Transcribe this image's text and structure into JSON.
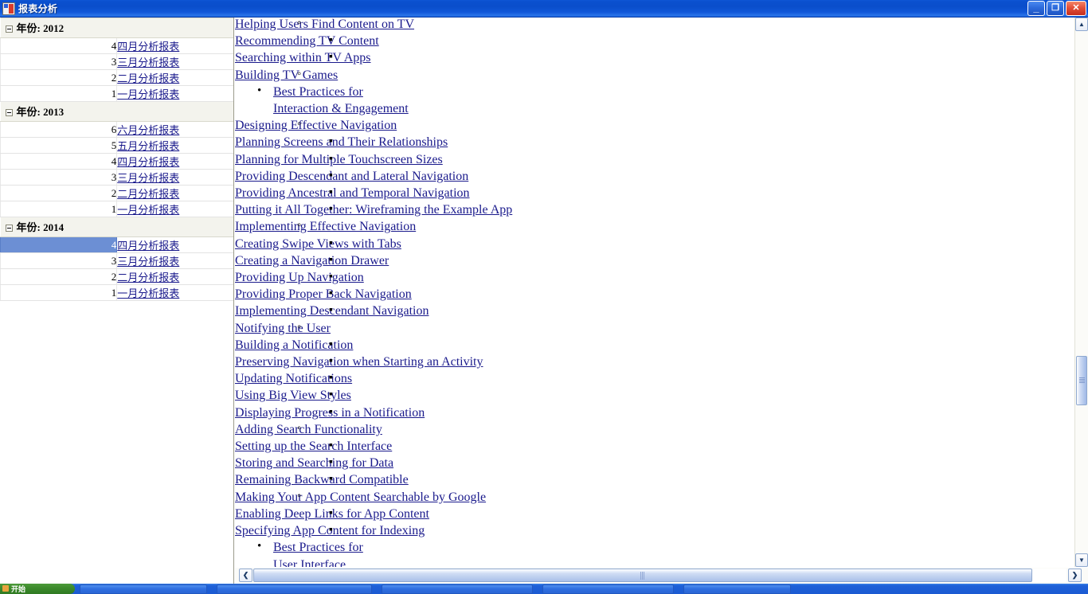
{
  "window": {
    "title": "报表分析",
    "icon": "report-window-icon",
    "buttons": {
      "minimize": "_",
      "restore": "❐",
      "close": "✕"
    }
  },
  "sidebar": {
    "groups": [
      {
        "label": "年份: 2012",
        "expander": "collapse-box",
        "rows": [
          {
            "num": "4",
            "link": "四月分析报表",
            "selected": false
          },
          {
            "num": "3",
            "link": "三月分析报表",
            "selected": false
          },
          {
            "num": "2",
            "link": "二月分析报表",
            "selected": false
          },
          {
            "num": "1",
            "link": "一月分析报表",
            "selected": false
          }
        ]
      },
      {
        "label": "年份: 2013",
        "expander": "collapse-box",
        "rows": [
          {
            "num": "6",
            "link": "六月分析报表",
            "selected": false
          },
          {
            "num": "5",
            "link": "五月分析报表",
            "selected": false
          },
          {
            "num": "4",
            "link": "四月分析报表",
            "selected": false
          },
          {
            "num": "3",
            "link": "三月分析报表",
            "selected": false
          },
          {
            "num": "2",
            "link": "二月分析报表",
            "selected": false
          },
          {
            "num": "1",
            "link": "一月分析报表",
            "selected": false
          }
        ]
      },
      {
        "label": "年份: 2014",
        "expander": "collapse-box",
        "rows": [
          {
            "num": "4",
            "link": "四月分析报表",
            "selected": true
          },
          {
            "num": "3",
            "link": "三月分析报表",
            "selected": false
          },
          {
            "num": "2",
            "link": "二月分析报表",
            "selected": false
          },
          {
            "num": "1",
            "link": "一月分析报表",
            "selected": false
          }
        ]
      }
    ]
  },
  "content": {
    "items": [
      {
        "level": 2,
        "text": "Helping Users Find Content on TV"
      },
      {
        "level": 3,
        "text": "Recommending TV Content"
      },
      {
        "level": 3,
        "text": "Searching within TV Apps"
      },
      {
        "level": 2,
        "text": "Building TV Games"
      },
      {
        "level": 1,
        "text": "Best Practices for Interaction & Engagement",
        "wrap": true
      },
      {
        "level": 2,
        "text": "Designing Effective Navigation"
      },
      {
        "level": 3,
        "text": "Planning Screens and Their Relationships"
      },
      {
        "level": 3,
        "text": "Planning for Multiple Touchscreen Sizes"
      },
      {
        "level": 3,
        "text": "Providing Descendant and Lateral Navigation"
      },
      {
        "level": 3,
        "text": "Providing Ancestral and Temporal Navigation"
      },
      {
        "level": 3,
        "text": "Putting it All Together: Wireframing the Example App"
      },
      {
        "level": 2,
        "text": "Implementing Effective Navigation"
      },
      {
        "level": 3,
        "text": "Creating Swipe Views with Tabs"
      },
      {
        "level": 3,
        "text": "Creating a Navigation Drawer"
      },
      {
        "level": 3,
        "text": "Providing Up Navigation"
      },
      {
        "level": 3,
        "text": "Providing Proper Back Navigation"
      },
      {
        "level": 3,
        "text": "Implementing Descendant Navigation"
      },
      {
        "level": 2,
        "text": "Notifying the User"
      },
      {
        "level": 3,
        "text": "Building a Notification"
      },
      {
        "level": 3,
        "text": "Preserving Navigation when Starting an Activity"
      },
      {
        "level": 3,
        "text": "Updating Notifications"
      },
      {
        "level": 3,
        "text": "Using Big View Styles"
      },
      {
        "level": 3,
        "text": "Displaying Progress in a Notification"
      },
      {
        "level": 2,
        "text": "Adding Search Functionality"
      },
      {
        "level": 3,
        "text": "Setting up the Search Interface"
      },
      {
        "level": 3,
        "text": "Storing and Searching for Data"
      },
      {
        "level": 3,
        "text": "Remaining Backward Compatible"
      },
      {
        "level": 2,
        "text": "Making Your App Content Searchable by Google"
      },
      {
        "level": 3,
        "text": "Enabling Deep Links for App Content"
      },
      {
        "level": 3,
        "text": "Specifying App Content for Indexing"
      },
      {
        "level": 1,
        "text": "Best Practices for User Interface",
        "wrap": true
      }
    ]
  },
  "scrollbars": {
    "vertical": {
      "up_arrow": "▲",
      "down_arrow": "▼"
    },
    "horizontal": {
      "left_arrow": "❮",
      "right_arrow": "❯"
    }
  },
  "taskbar": {
    "start_label": "开始",
    "tasks": [
      "",
      "",
      "",
      "",
      ""
    ]
  }
}
